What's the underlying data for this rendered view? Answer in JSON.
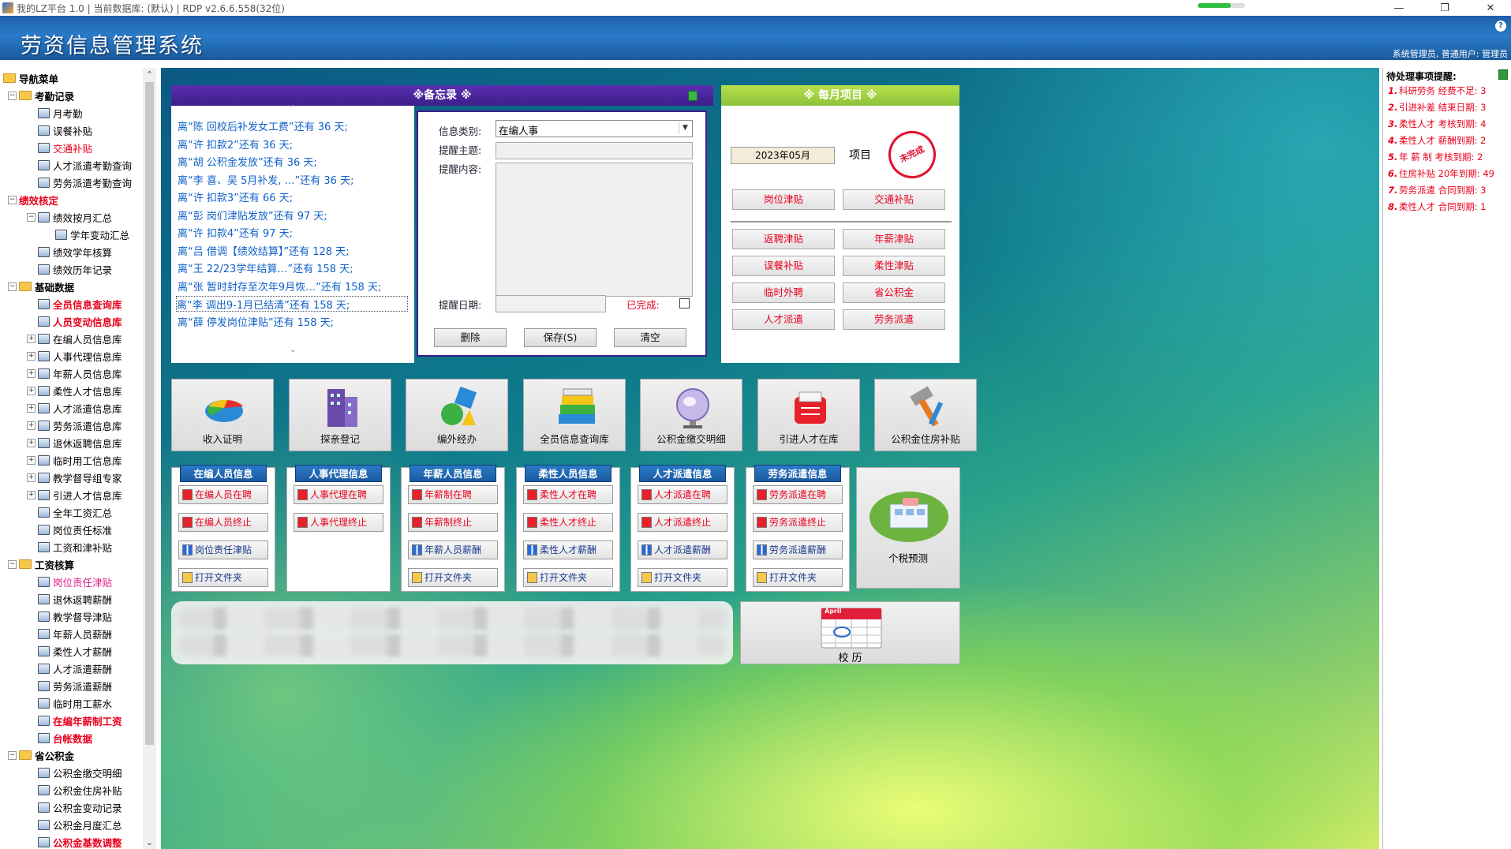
{
  "window": {
    "title": "我的LZ平台 1.0 | 当前数据库: (默认) | RDP v2.6.6.558(32位)",
    "minimize": "—",
    "maximize": "❐",
    "close": "✕"
  },
  "header": {
    "title": "劳资信息管理系统",
    "user": "系统管理员, 普通用户: 管理员",
    "help": "?"
  },
  "nav": {
    "root": "导航菜单",
    "rows": [
      {
        "label": "考勤记录",
        "level": 0,
        "style": "bold",
        "expander": "−",
        "icon": "folder-icon"
      },
      {
        "label": "月考勤",
        "level": 1,
        "style": "",
        "icon": "calendar-icon"
      },
      {
        "label": "误餐补贴",
        "level": 1,
        "style": "",
        "icon": "grid-icon"
      },
      {
        "label": "交通补贴",
        "level": 1,
        "style": "sel",
        "icon": "car-icon"
      },
      {
        "label": "人才派遣考勤查询",
        "level": 1,
        "style": "",
        "icon": "chart-icon"
      },
      {
        "label": "劳务派遣考勤查询",
        "level": 1,
        "style": "",
        "icon": "tools-icon"
      },
      {
        "label": "绩效核定",
        "level": 0,
        "style": "red",
        "expander": "−",
        "icon": ""
      },
      {
        "label": "绩效按月汇总",
        "level": 1,
        "style": "",
        "expander": "−",
        "icon": "doc-icon"
      },
      {
        "label": "学年变动汇总",
        "level": 2,
        "style": "",
        "icon": "doc-icon"
      },
      {
        "label": "绩效学年核算",
        "level": 1,
        "style": "",
        "icon": "doc-icon"
      },
      {
        "label": "绩效历年记录",
        "level": 1,
        "style": "",
        "icon": "doc-icon"
      },
      {
        "label": "基础数据",
        "level": 0,
        "style": "bold",
        "expander": "−",
        "icon": "folder-icon"
      },
      {
        "label": "全员信息查询库",
        "level": 1,
        "style": "red",
        "icon": "person-icon"
      },
      {
        "label": "人员变动信息库",
        "level": 1,
        "style": "red",
        "icon": "person-icon"
      },
      {
        "label": "在编人员信息库",
        "level": 1,
        "style": "",
        "expander": "+",
        "icon": "db-icon"
      },
      {
        "label": "人事代理信息库",
        "level": 1,
        "style": "",
        "expander": "+",
        "icon": "db-icon"
      },
      {
        "label": "年薪人员信息库",
        "level": 1,
        "style": "",
        "expander": "+",
        "icon": "db-icon"
      },
      {
        "label": "柔性人才信息库",
        "level": 1,
        "style": "",
        "expander": "+",
        "icon": "db-icon"
      },
      {
        "label": "人才派遣信息库",
        "level": 1,
        "style": "",
        "expander": "+",
        "icon": "db-icon"
      },
      {
        "label": "劳务派遣信息库",
        "level": 1,
        "style": "",
        "expander": "+",
        "icon": "db-icon"
      },
      {
        "label": "退休返聘信息库",
        "level": 1,
        "style": "",
        "expander": "+",
        "icon": "db-icon"
      },
      {
        "label": "临时用工信息库",
        "level": 1,
        "style": "",
        "expander": "+",
        "icon": "db-icon"
      },
      {
        "label": "教学督导组专家",
        "level": 1,
        "style": "",
        "expander": "+",
        "icon": "db-icon"
      },
      {
        "label": "引进人才信息库",
        "level": 1,
        "style": "",
        "expander": "+",
        "icon": "db-icon"
      },
      {
        "label": "全年工资汇总",
        "level": 1,
        "style": "",
        "icon": "doc-icon"
      },
      {
        "label": "岗位责任标准",
        "level": 1,
        "style": "",
        "icon": "list-icon"
      },
      {
        "label": "工资和津补贴",
        "level": 1,
        "style": "",
        "icon": "doc-icon"
      },
      {
        "label": "工资核算",
        "level": 0,
        "style": "bold",
        "expander": "−",
        "icon": "folder-icon"
      },
      {
        "label": "岗位责任津贴",
        "level": 1,
        "style": "pink",
        "icon": "green-icon"
      },
      {
        "label": "退休返聘薪酬",
        "level": 1,
        "style": "",
        "icon": "doc-icon"
      },
      {
        "label": "教学督导津贴",
        "level": 1,
        "style": "",
        "icon": "chart-icon"
      },
      {
        "label": "年薪人员薪酬",
        "level": 1,
        "style": "",
        "icon": "doc-icon"
      },
      {
        "label": "柔性人才薪酬",
        "level": 1,
        "style": "",
        "icon": "clock-icon"
      },
      {
        "label": "人才派遣薪酬",
        "level": 1,
        "style": "",
        "icon": "doc-icon"
      },
      {
        "label": "劳务派遣薪酬",
        "level": 1,
        "style": "",
        "icon": "doc-icon"
      },
      {
        "label": "临时用工薪水",
        "level": 1,
        "style": "",
        "icon": "doc-icon"
      },
      {
        "label": "在编年薪制工资",
        "level": 1,
        "style": "red",
        "icon": "tools-icon"
      },
      {
        "label": "台帐数据",
        "level": 1,
        "style": "red",
        "icon": "doc-icon"
      },
      {
        "label": "省公积金",
        "level": 0,
        "style": "bold",
        "expander": "−",
        "icon": "folder-icon"
      },
      {
        "label": "公积金缴交明细",
        "level": 1,
        "style": "",
        "icon": "globe-icon"
      },
      {
        "label": "公积金住房补贴",
        "level": 1,
        "style": "",
        "icon": "sigma-icon"
      },
      {
        "label": "公积金变动记录",
        "level": 1,
        "style": "",
        "icon": "doc-icon"
      },
      {
        "label": "公积金月度汇总",
        "level": 1,
        "style": "",
        "icon": "doc-icon"
      },
      {
        "label": "公积金基数调整",
        "level": 1,
        "style": "red",
        "icon": "doc-icon"
      }
    ]
  },
  "memo": {
    "title": "※备忘录 ※",
    "items": [
      "离“陈    回校后补发女工费”还有 36 天;",
      "离“许       扣款2”还有 36 天;",
      "离“胡   公积金发放”还有 36 天;",
      "离“李  喜、吴      5月补发, …”还有 36 天;",
      "离“许       扣款3”还有 66 天;",
      "离“彭       岗们津贴发放”还有 97 天;",
      "离“许       扣款4”还有 97 天;",
      "离“吕   借调【绩效结算】”还有 128 天;",
      "离“王       22/23学年结算…”还有 158 天;",
      "离“张   暂时封存至次年9月恢…”还有 158 天;",
      "离“李       调出9-1月已结清”还有 158 天;",
      "离“薛       停发岗位津贴”还有 158 天;"
    ],
    "selected_index": 10,
    "form": {
      "category_label": "信息类别:",
      "category_value": "在编人事",
      "subject_label": "提醒主题:",
      "content_label": "提醒内容:",
      "date_label": "提醒日期:",
      "done_label": "已完成:",
      "delete": "删除",
      "save": "保存(S)",
      "clear": "清空"
    }
  },
  "monthly": {
    "title": "※ 每月项目 ※",
    "date": "2023年05月",
    "item_label": "项目",
    "stamp": "未完成",
    "buttons_top": [
      "岗位津贴",
      "交通补贴"
    ],
    "buttons": [
      "返聘津贴",
      "年薪津贴",
      "误餐补贴",
      "柔性津贴",
      "临时外聘",
      "省公积金",
      "人才派遣",
      "劳务派遣"
    ]
  },
  "tiles": [
    {
      "label": "收入证明",
      "icon": "pie-chart-icon"
    },
    {
      "label": "探亲登记",
      "icon": "building-icon"
    },
    {
      "label": "编外经办",
      "icon": "shapes-icon"
    },
    {
      "label": "全员信息查询库",
      "icon": "books-icon"
    },
    {
      "label": "公积金缴交明细",
      "icon": "globe-icon"
    },
    {
      "label": "引进人才在库",
      "icon": "rolodex-icon"
    },
    {
      "label": "公积金住房补贴",
      "icon": "hammer-icon"
    }
  ],
  "categories": [
    {
      "title": "在编人员信息",
      "buttons": [
        "在编人员在聘",
        "在编人员终止",
        "岗位责任津贴",
        "打开文件夹"
      ]
    },
    {
      "title": "人事代理信息",
      "buttons": [
        "人事代理在聘",
        "人事代理终止"
      ]
    },
    {
      "title": "年薪人员信息",
      "buttons": [
        "年薪制在聘",
        "年薪制终止",
        "年薪人员薪酬",
        "打开文件夹"
      ]
    },
    {
      "title": "柔性人员信息",
      "buttons": [
        "柔性人才在聘",
        "柔性人才终止",
        "柔性人才薪酬",
        "打开文件夹"
      ]
    },
    {
      "title": "人才派遣信息",
      "buttons": [
        "人才派遣在聘",
        "人才派遣终止",
        "人才派遣薪酬",
        "打开文件夹"
      ]
    },
    {
      "title": "劳务派遣信息",
      "buttons": [
        "劳务派遣在聘",
        "劳务派遣终止",
        "劳务派遣薪酬",
        "打开文件夹"
      ]
    }
  ],
  "tax": {
    "label": "个税预测"
  },
  "calendar": {
    "label": "校  历",
    "month": "April"
  },
  "todo": {
    "title": "待处理事项提醒:",
    "items": [
      {
        "n": "1.",
        "text": "科研劳务   经费不足: 3"
      },
      {
        "n": "2.",
        "text": "引进补差   结束日期: 3"
      },
      {
        "n": "3.",
        "text": "柔性人才   考核到期: 4"
      },
      {
        "n": "4.",
        "text": "柔性人才   薪酬到期: 2"
      },
      {
        "n": "5.",
        "text": "年 薪 制   考核到期: 2"
      },
      {
        "n": "6.",
        "text": "住房补贴   20年到期: 49"
      },
      {
        "n": "7.",
        "text": "劳务派遣   合同到期: 3"
      },
      {
        "n": "8.",
        "text": "柔性人才   合同到期: 1"
      }
    ]
  }
}
